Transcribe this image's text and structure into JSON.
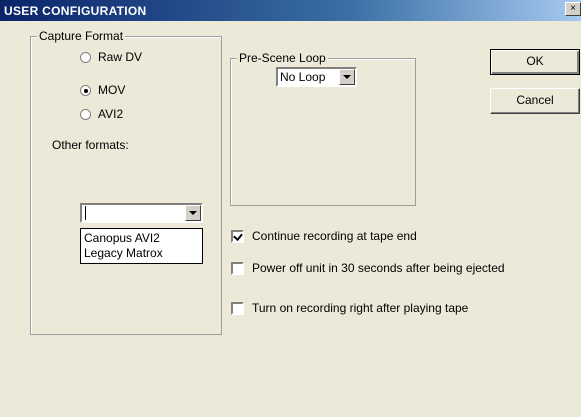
{
  "window": {
    "title": "USER CONFIGURATION",
    "close_glyph": "×"
  },
  "capture_format": {
    "legend": "Capture Format",
    "options": [
      {
        "label": "Raw DV",
        "checked": false
      },
      {
        "label": "MOV",
        "checked": true
      },
      {
        "label": "AVI2",
        "checked": false
      }
    ],
    "other_formats_label": "Other formats:",
    "other_formats_value": "",
    "other_formats_options": [
      "Canopus AVI2",
      "Legacy Matrox"
    ]
  },
  "pre_scene_loop": {
    "legend": "Pre-Scene Loop",
    "selected": "No Loop"
  },
  "buttons": {
    "ok": "OK",
    "cancel": "Cancel"
  },
  "options": [
    {
      "label": "Continue recording at tape end",
      "checked": true
    },
    {
      "label": "Power off unit in 30 seconds after being ejected",
      "checked": false
    },
    {
      "label": "Turn on recording right after playing tape",
      "checked": false
    }
  ]
}
